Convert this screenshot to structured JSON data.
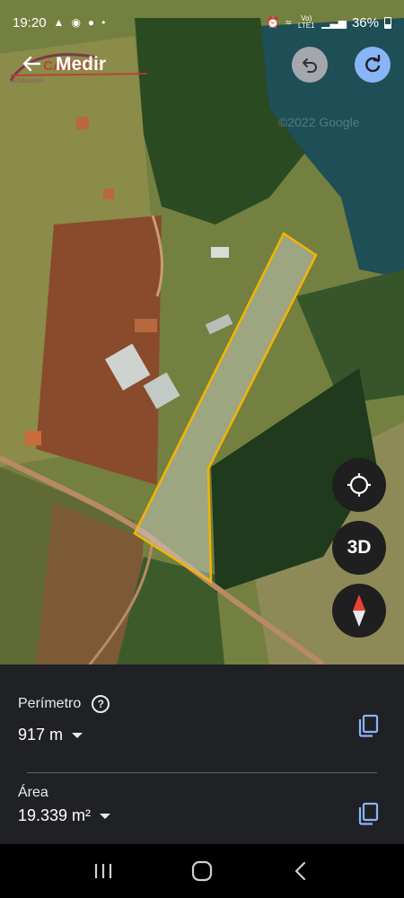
{
  "status_bar": {
    "time": "19:20",
    "network_label": "Vo) LTE1",
    "battery": "36%"
  },
  "top_bar": {
    "title": "Medir",
    "watermark_text": "CAMBAR",
    "watermark_subtext": "IMOBILIÁRIA"
  },
  "map": {
    "attribution": "©2022 Google",
    "measure_color": "#f4b400"
  },
  "controls": {
    "three_d_label": "3D"
  },
  "panel": {
    "perimeter_label": "Perímetro",
    "perimeter_value": "917 m",
    "area_label": "Área",
    "area_value": "19.339 m²"
  },
  "colors": {
    "accent": "#8ab4f8",
    "panel_bg": "#202124",
    "compass_red": "#ea4335"
  }
}
